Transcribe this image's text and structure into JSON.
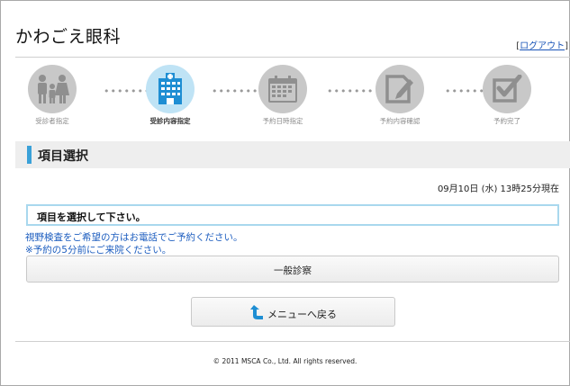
{
  "header": {
    "clinic_name": "かわごえ眼科",
    "logout_open": "[",
    "logout_label": "ログアウト",
    "logout_close": "]"
  },
  "steps": [
    {
      "label": "受診者指定",
      "icon": "family-icon",
      "active": false
    },
    {
      "label": "受診内容指定",
      "icon": "hospital-icon",
      "active": true
    },
    {
      "label": "予約日時指定",
      "icon": "calendar-icon",
      "active": false
    },
    {
      "label": "予約内容確認",
      "icon": "edit-document-icon",
      "active": false
    },
    {
      "label": "予約完了",
      "icon": "checkbox-icon",
      "active": false
    }
  ],
  "step_separator": "•••••••",
  "section": {
    "title": "項目選択"
  },
  "datetime": "09月10日 (水) 13時25分現在",
  "instruction": "項目を選択して下さい。",
  "notices": [
    "視野検査をご希望の方はお電話でご予約ください。",
    "※予約の5分前にご来院ください。"
  ],
  "buttons": {
    "exam_label": "一般診察",
    "back_label": "メニューへ戻る"
  },
  "footer": {
    "copyright": "© 2011 MSCA Co., Ltd. All rights reserved."
  },
  "colors": {
    "accent": "#3aa1d8",
    "active_step_bg": "#bfe3f5",
    "inactive_step_bg": "#c8c8c8",
    "notice_text": "#1c5dbf",
    "instruction_border": "#a9d8ee"
  }
}
